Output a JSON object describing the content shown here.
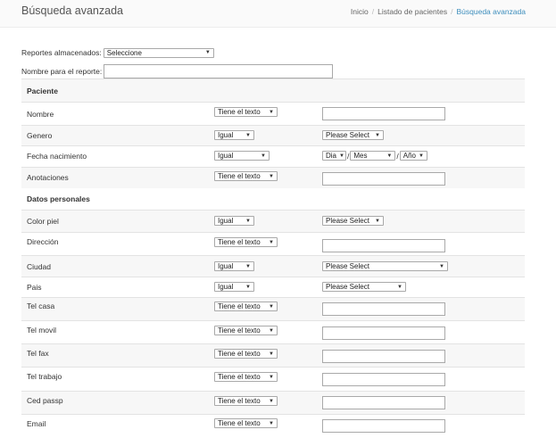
{
  "header": {
    "title": "Búsqueda avanzada",
    "breadcrumb": [
      "Inicio",
      "Listado de pacientes",
      "Búsqueda avanzada"
    ],
    "separator": "/"
  },
  "top_form": {
    "stored_reports_label": "Reportes almacenados:",
    "stored_reports_value": "Seleccione",
    "report_name_label": "Nombre para el reporte:",
    "report_name_value": ""
  },
  "sections": {
    "paciente": "Paciente",
    "datos_personales": "Datos personales"
  },
  "rows": {
    "nombre": {
      "label": "Nombre",
      "op": "Tiene el texto"
    },
    "genero": {
      "label": "Genero",
      "op": "Igual",
      "value": "Please Select"
    },
    "fecha": {
      "label": "Fecha nacimiento",
      "op": "Igual",
      "day": "Dia",
      "month": "Mes",
      "year": "Año",
      "sep": "/"
    },
    "anotaciones": {
      "label": "Anotaciones",
      "op": "Tiene el texto"
    },
    "color_piel": {
      "label": "Color piel",
      "op": "Igual",
      "value": "Please Select"
    },
    "direccion": {
      "label": "Dirección",
      "op": "Tiene el texto"
    },
    "ciudad": {
      "label": "Ciudad",
      "op": "Igual",
      "value": "Please Select"
    },
    "pais": {
      "label": "Pais",
      "op": "Igual",
      "value": "Please Select"
    },
    "tel_casa": {
      "label": "Tel casa",
      "op": "Tiene el texto"
    },
    "tel_movil": {
      "label": "Tel movil",
      "op": "Tiene el texto"
    },
    "tel_fax": {
      "label": "Tel fax",
      "op": "Tiene el texto"
    },
    "tel_trabajo": {
      "label": "Tel trabajo",
      "op": "Tiene el texto"
    },
    "ced_passp": {
      "label": "Ced passp",
      "op": "Tiene el texto"
    },
    "email": {
      "label": "Email",
      "op": "Tiene el texto"
    }
  },
  "icons": {
    "dropdown": "chevron-down-icon"
  }
}
